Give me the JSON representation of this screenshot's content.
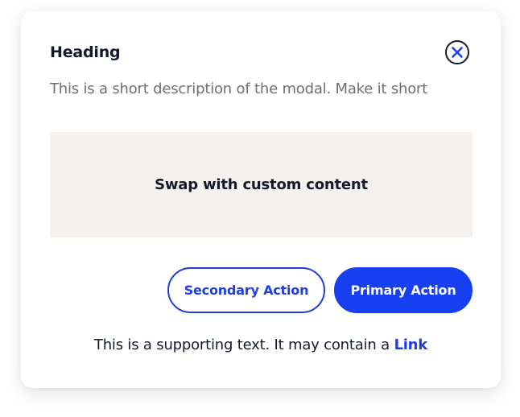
{
  "modal": {
    "heading": "Heading",
    "description": "This is a short description of the modal. Make it short",
    "close_icon": "close-icon",
    "custom_content_label": "Swap with custom content",
    "secondary_action_label": "Secondary Action",
    "primary_action_label": "Primary Action",
    "supporting_text": "This is a supporting text. It may contain a",
    "link_label": "Link"
  },
  "colors": {
    "accent": "#1840f0",
    "text_dark": "#141a2e",
    "text_muted": "#6b7077",
    "content_placeholder_bg": "#f4f1ee"
  }
}
